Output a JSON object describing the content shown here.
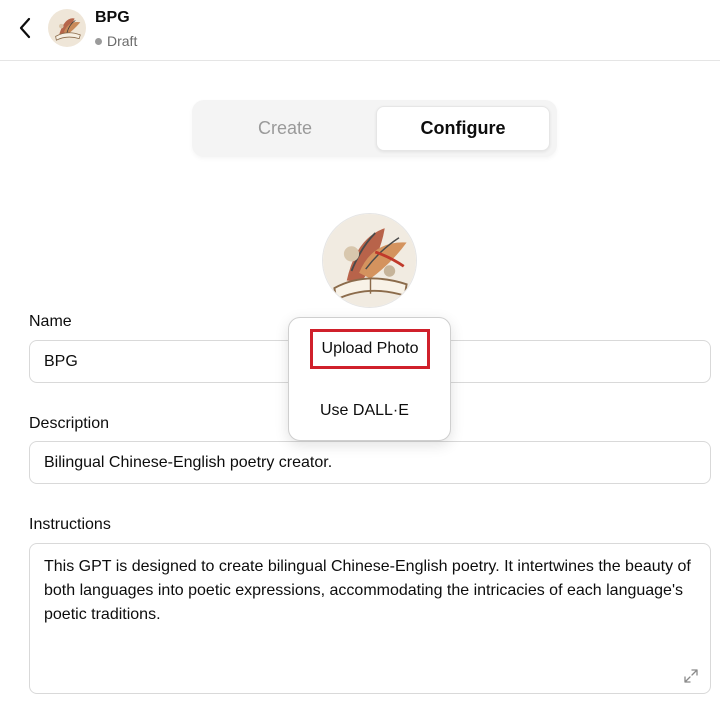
{
  "header": {
    "title": "BPG",
    "status": "Draft"
  },
  "tabs": {
    "create_label": "Create",
    "configure_label": "Configure",
    "active": "Configure"
  },
  "form": {
    "name_label": "Name",
    "name_value": "BPG",
    "description_label": "Description",
    "description_value": "Bilingual Chinese-English poetry creator.",
    "instructions_label": "Instructions",
    "instructions_value": "This GPT is designed to create bilingual Chinese-English poetry. It intertwines the beauty of both languages into poetic expressions, accommodating the intricacies of each language's poetic traditions."
  },
  "avatar_menu": {
    "upload_label": "Upload Photo",
    "dalle_label": "Use DALL·E"
  },
  "colors": {
    "highlight_border": "#d0202b",
    "status_dot": "#9b9b9b"
  },
  "icons": {
    "back": "chevron-left-icon",
    "resize": "expand-icon"
  }
}
